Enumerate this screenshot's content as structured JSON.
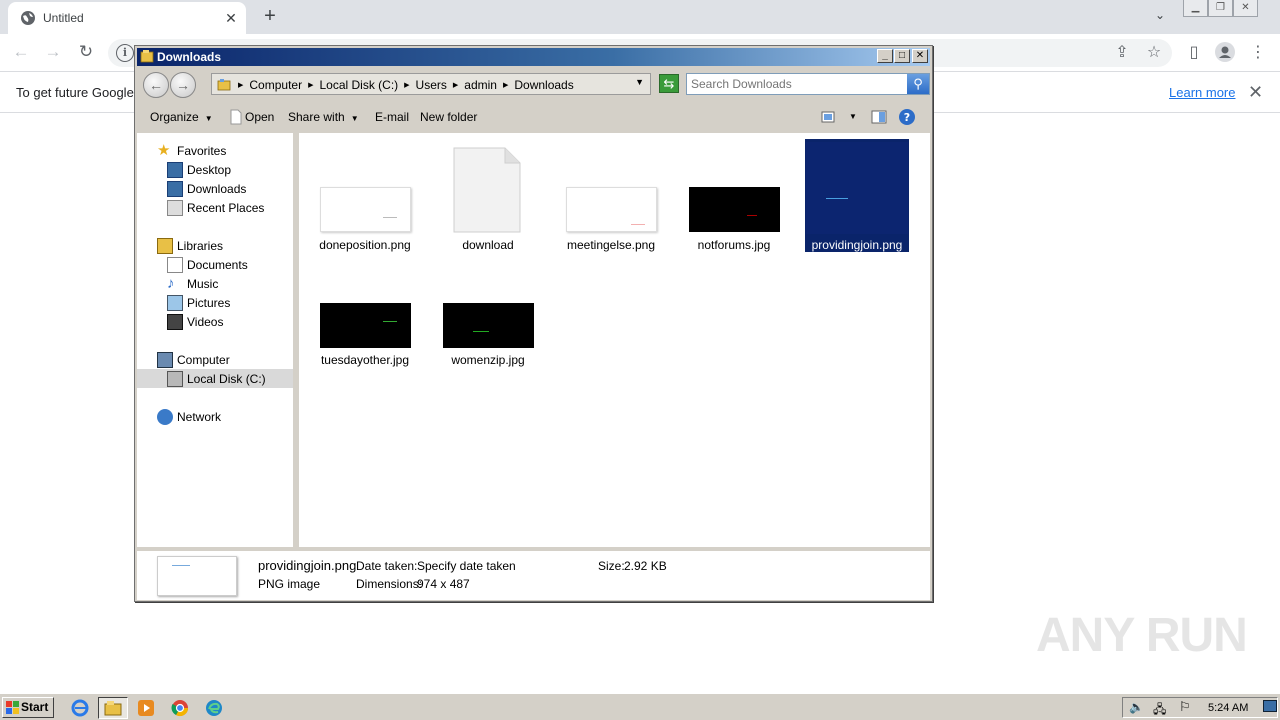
{
  "browser": {
    "tab_title": "Untitled",
    "infobar_message": "To get future Google",
    "infobar_link": "Learn more"
  },
  "explorer": {
    "title": "Downloads",
    "breadcrumbs": [
      "Computer",
      "Local Disk (C:)",
      "Users",
      "admin",
      "Downloads"
    ],
    "search_placeholder": "Search Downloads",
    "commands": {
      "organize": "Organize",
      "open": "Open",
      "share_with": "Share with",
      "email": "E-mail",
      "new_folder": "New folder"
    },
    "nav": {
      "favorites": "Favorites",
      "desktop": "Desktop",
      "downloads": "Downloads",
      "recent_places": "Recent Places",
      "libraries": "Libraries",
      "documents": "Documents",
      "music": "Music",
      "pictures": "Pictures",
      "videos": "Videos",
      "computer": "Computer",
      "local_disk": "Local Disk (C:)",
      "network": "Network"
    },
    "files": [
      {
        "name": "doneposition.png",
        "kind": "white-thumb"
      },
      {
        "name": "download",
        "kind": "blank-doc"
      },
      {
        "name": "meetingelse.png",
        "kind": "white-thumb"
      },
      {
        "name": "notforums.jpg",
        "kind": "black-thumb"
      },
      {
        "name": "providingjoin.png",
        "kind": "navy-thumb",
        "selected": true
      },
      {
        "name": "tuesdayother.jpg",
        "kind": "black-thumb"
      },
      {
        "name": "womenzip.jpg",
        "kind": "black-thumb"
      }
    ],
    "details": {
      "filename": "providingjoin.png",
      "filetype": "PNG image",
      "date_taken_label": "Date taken:",
      "date_taken_value": "Specify date taken",
      "dimensions_label": "Dimensions:",
      "dimensions_value": "974 x 487",
      "size_label": "Size:",
      "size_value": "2.92 KB"
    }
  },
  "taskbar": {
    "start_label": "Start",
    "clock": "5:24 AM"
  },
  "watermark": "ANY RUN",
  "colors": {
    "selection": "#0a246a",
    "titlebar_start": "#0a246a",
    "titlebar_end": "#a6caf0",
    "link": "#1a73e8"
  }
}
